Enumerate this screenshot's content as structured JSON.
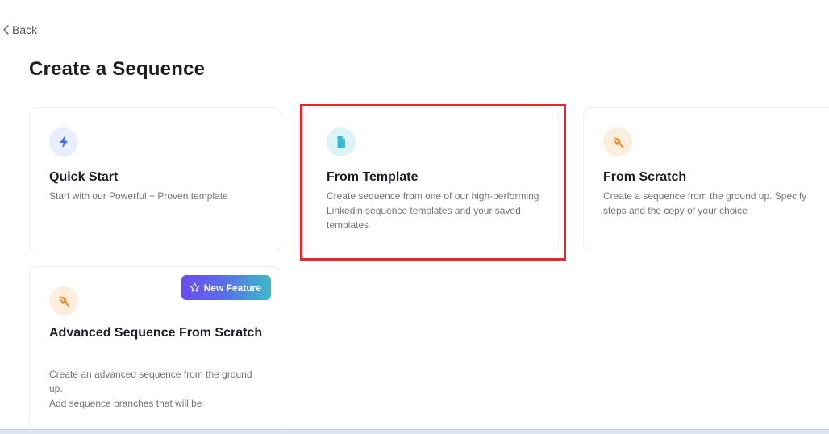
{
  "nav": {
    "back_label": "Back"
  },
  "page": {
    "title": "Create a Sequence"
  },
  "cards": [
    {
      "icon": "lightning-icon",
      "title": "Quick Start",
      "description": "Start with our Powerful + Proven template"
    },
    {
      "icon": "document-icon",
      "title": "From Template",
      "description": "Create sequence from one of our high-performing Linkedin sequence templates and your saved templates",
      "highlighted": true
    },
    {
      "icon": "pen-nib-icon",
      "title": "From Scratch",
      "description": "Create a sequence from the ground up. Specify steps and the copy of your choice"
    },
    {
      "icon": "pen-nib-icon",
      "title": "Advanced Sequence From Scratch",
      "description": "Create an advanced sequence from the ground up.\nAdd sequence branches that will be",
      "badge": "New Feature"
    }
  ],
  "colors": {
    "highlight": "#e8262a",
    "icon_blue": "#3f6df0",
    "icon_cyan": "#2fc0d8",
    "icon_orange": "#f28b22",
    "badge_start": "#6a4cf0",
    "badge_end": "#3dbbc8"
  }
}
